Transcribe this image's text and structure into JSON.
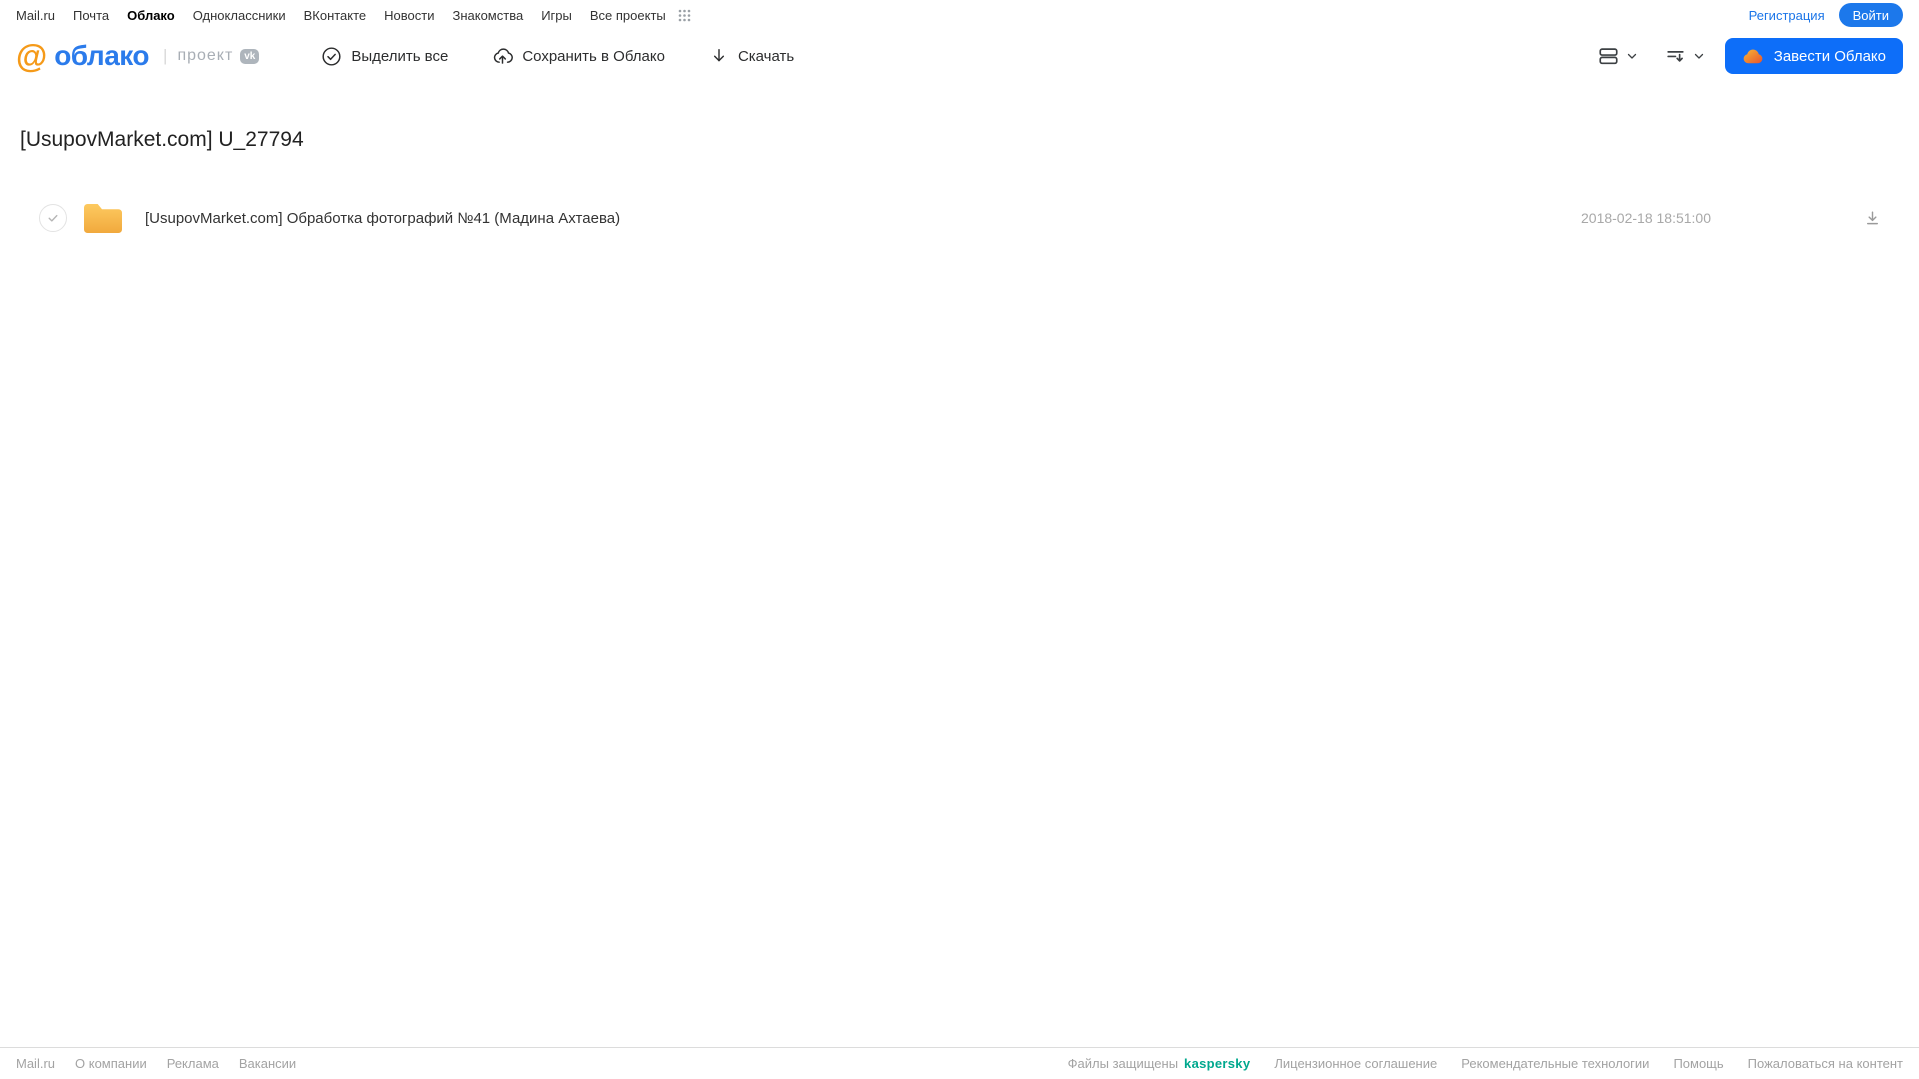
{
  "topnav": {
    "items": [
      {
        "label": "Mail.ru"
      },
      {
        "label": "Почта"
      },
      {
        "label": "Облако"
      },
      {
        "label": "Одноклассники"
      },
      {
        "label": "ВКонтакте"
      },
      {
        "label": "Новости"
      },
      {
        "label": "Знакомства"
      },
      {
        "label": "Игры"
      },
      {
        "label": "Все проекты"
      }
    ],
    "active_item": "Облако",
    "registration_label": "Регистрация",
    "login_label": "Войти"
  },
  "header": {
    "logo_at": "@",
    "logo_text": "облако",
    "logo_separator": "|",
    "project_label": "проект",
    "vk_badge": "vk",
    "toolbar": {
      "select_all": "Выделить все",
      "save_to_cloud": "Сохранить в Облако",
      "download": "Скачать"
    },
    "create_cloud_button": "Завести Облако"
  },
  "main": {
    "title": "[UsupovMarket.com] U_27794",
    "files": [
      {
        "type": "folder",
        "name": "[UsupovMarket.com] Обработка фотографий №41 (Мадина Ахтаева)",
        "date": "2018-02-18 18:51:00"
      }
    ]
  },
  "footer": {
    "left_links": [
      {
        "label": "Mail.ru"
      },
      {
        "label": "О компании"
      },
      {
        "label": "Реклама"
      },
      {
        "label": "Вакансии"
      }
    ],
    "protected_text": "Файлы защищены",
    "kaspersky_label": "kaspersky",
    "right_links": [
      {
        "label": "Лицензионное соглашение"
      },
      {
        "label": "Рекомендательные технологии"
      },
      {
        "label": "Помощь"
      },
      {
        "label": "Пожаловаться на контент"
      }
    ]
  },
  "colors": {
    "accent_blue": "#0d6ef9",
    "login_blue": "#1c78eb",
    "logo_orange": "#f59a19",
    "logo_blue": "#2b7beb",
    "folder_top": "#fdca60",
    "folder_bottom": "#f1a93d",
    "kaspersky_teal": "#00a88e",
    "muted_gray": "#a8a8a8"
  }
}
